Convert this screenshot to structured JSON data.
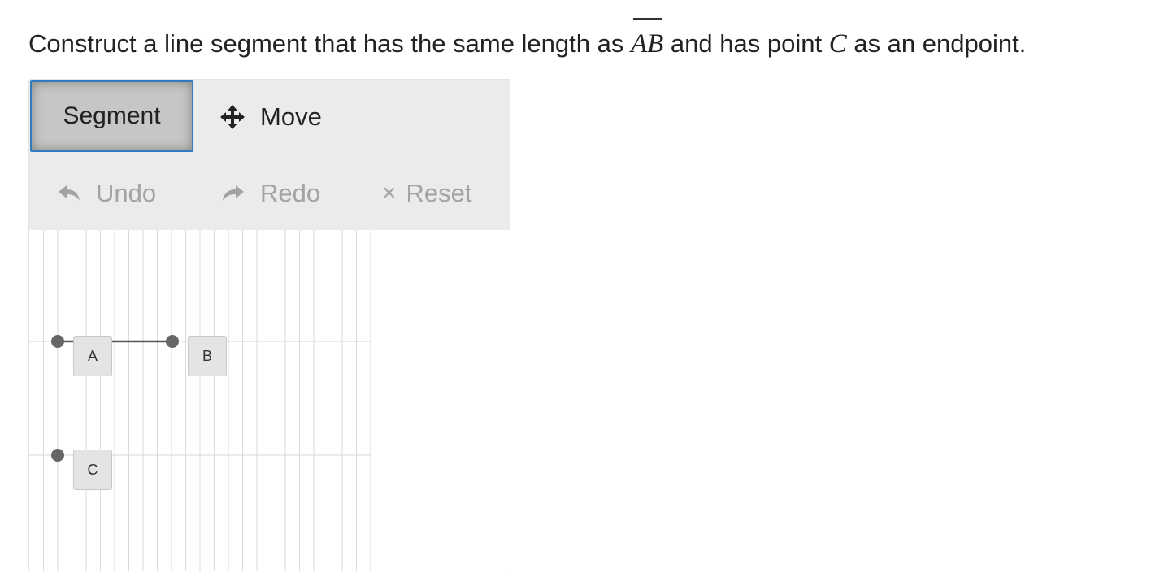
{
  "question": {
    "before": "Construct a line segment that has the same length as ",
    "segment_name": "AB",
    "middle": " and has point ",
    "point_name": "C",
    "after": " as an endpoint."
  },
  "toolbar": {
    "segment_label": "Segment",
    "move_label": "Move",
    "undo_label": "Undo",
    "redo_label": "Redo",
    "reset_symbol": "×",
    "reset_label": "Reset"
  },
  "canvas": {
    "points": [
      {
        "name": "A",
        "label": "A"
      },
      {
        "name": "B",
        "label": "B"
      },
      {
        "name": "C",
        "label": "C"
      }
    ]
  },
  "colors": {
    "selected_border": "#2e7bbd",
    "toolbar_bg": "#ebebeb",
    "muted_text": "#a3a3a3",
    "point_color": "#666666"
  },
  "icons": {
    "move": "move-arrows-icon",
    "undo": "undo-arrow-icon",
    "redo": "redo-arrow-icon",
    "reset": "close-icon"
  }
}
